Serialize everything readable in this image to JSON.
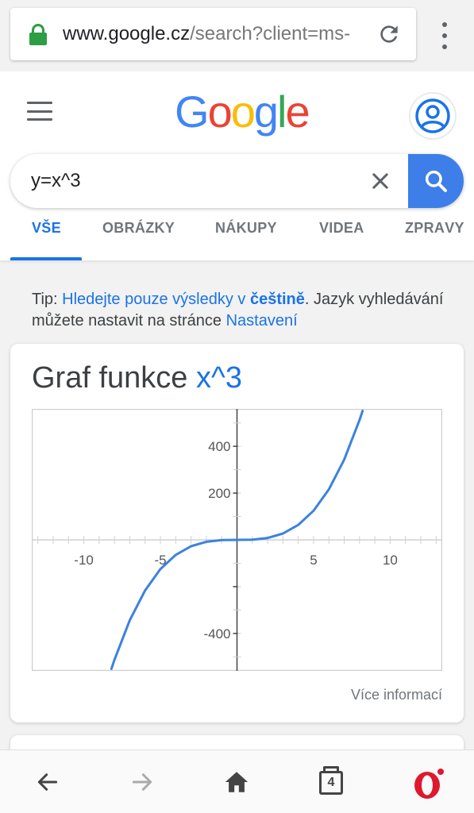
{
  "browser": {
    "url_host": "www.google.cz",
    "url_rest": "/search?client=ms-",
    "tab_count": "4"
  },
  "google": {
    "logo_letters": [
      {
        "char": "G",
        "color": "#4285F4"
      },
      {
        "char": "o",
        "color": "#EA4335"
      },
      {
        "char": "o",
        "color": "#FBBC05"
      },
      {
        "char": "g",
        "color": "#4285F4"
      },
      {
        "char": "l",
        "color": "#34A853"
      },
      {
        "char": "e",
        "color": "#EA4335"
      }
    ],
    "accent_color": "#1a73e8"
  },
  "search": {
    "query": "y=x^3"
  },
  "tabs": [
    {
      "label": "VŠE",
      "active": true
    },
    {
      "label": "OBRÁZKY",
      "active": false
    },
    {
      "label": "NÁKUPY",
      "active": false
    },
    {
      "label": "VIDEA",
      "active": false
    },
    {
      "label": "ZPRÁVY",
      "active": false
    }
  ],
  "tip": {
    "prefix": "Tip: ",
    "link1": "Hledejte pouze výsledky v ",
    "link1_bold": "češtině",
    "middle": ". Jazyk vyhledávání můžete nastavit na stránce ",
    "link2": "Nastavení"
  },
  "card": {
    "title_prefix": "Graf funkce ",
    "title_fn": "x^3",
    "more_info": "Více informací"
  },
  "chart_data": {
    "type": "line",
    "title": "Graf funkce x^3",
    "function": "y = x^3",
    "xlim": [
      -13.4,
      13.4
    ],
    "ylim": [
      -560,
      560
    ],
    "x_ticks": [
      -10,
      -5,
      5,
      10
    ],
    "y_ticks": [
      400,
      200,
      -400
    ],
    "grid": false,
    "series": [
      {
        "x": [
          -8.2,
          -8,
          -7,
          -6,
          -5,
          -4,
          -3,
          -2,
          -1,
          0,
          1,
          2,
          3,
          4,
          5,
          6,
          7,
          8,
          8.2
        ],
        "y": [
          -551.4,
          -512,
          -343,
          -216,
          -125,
          -64,
          -27,
          -8,
          -1,
          0,
          1,
          8,
          27,
          64,
          125,
          216,
          343,
          512,
          551.4
        ],
        "color": "#3b82e0"
      }
    ]
  }
}
